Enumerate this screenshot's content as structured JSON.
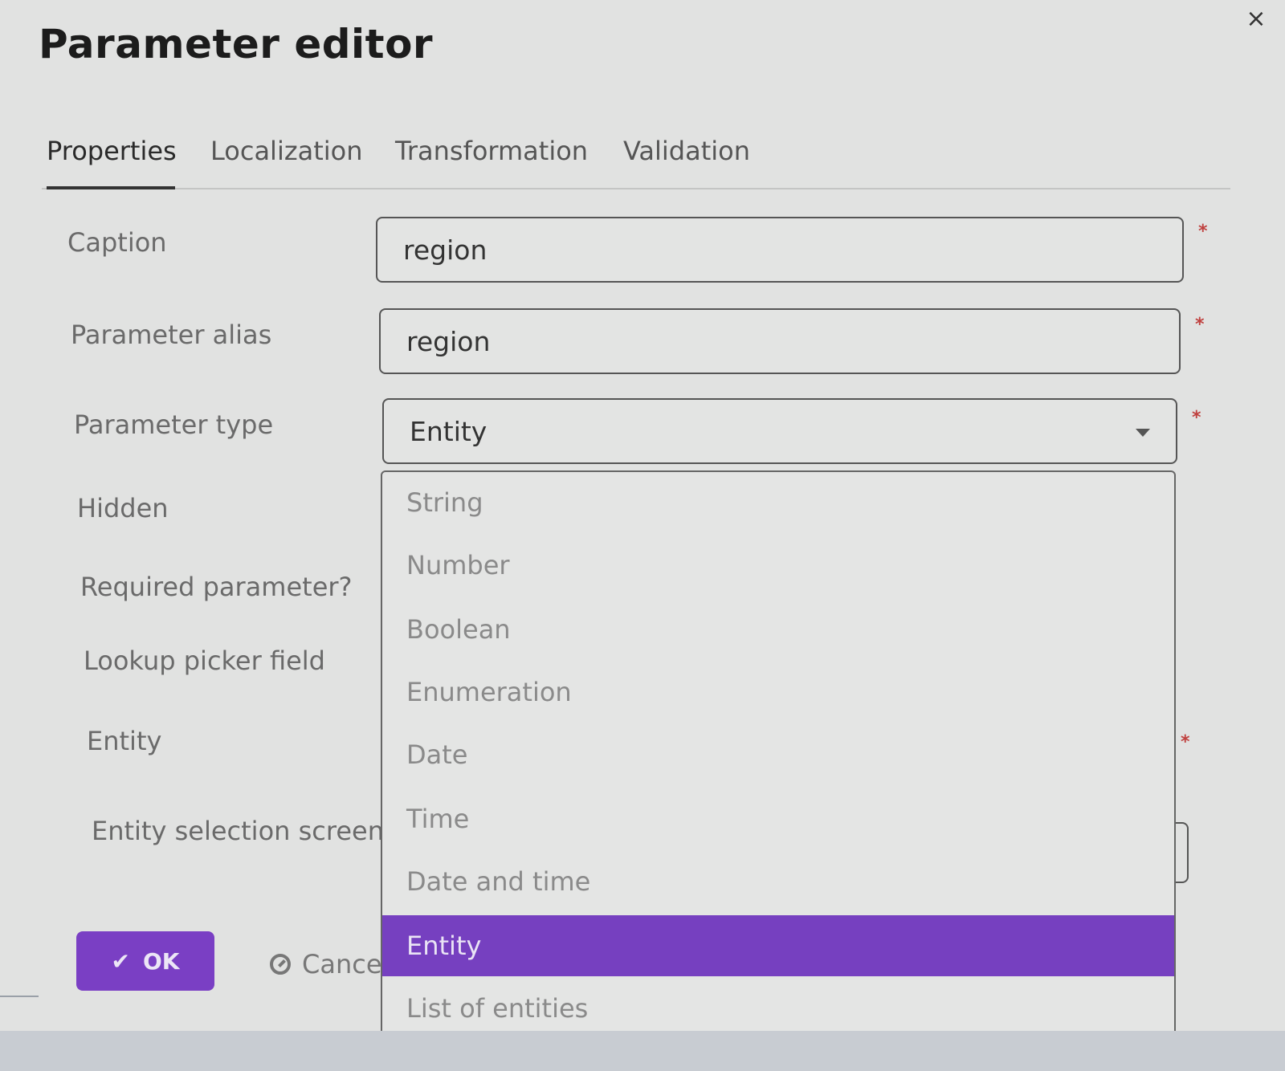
{
  "dialog": {
    "title": "Parameter editor",
    "close_icon": "×"
  },
  "tabs": [
    {
      "label": "Properties",
      "active": true
    },
    {
      "label": "Localization"
    },
    {
      "label": "Transformation"
    },
    {
      "label": "Validation"
    }
  ],
  "form": {
    "caption": {
      "label": "Caption",
      "value": "region",
      "required_mark": "*"
    },
    "alias": {
      "label": "Parameter alias",
      "value": "region",
      "required_mark": "*"
    },
    "type": {
      "label": "Parameter type",
      "value": "Entity",
      "required_mark": "*"
    },
    "hidden": {
      "label": "Hidden"
    },
    "required": {
      "label": "Required parameter?"
    },
    "lookup": {
      "label": "Lookup picker field"
    },
    "entity": {
      "label": "Entity",
      "required_mark": "*"
    },
    "screen": {
      "label": "Entity selection screen"
    }
  },
  "dropdown": {
    "options": [
      "String",
      "Number",
      "Boolean",
      "Enumeration",
      "Date",
      "Time",
      "Date and time",
      "Entity",
      "List of entities"
    ],
    "selected": "Entity"
  },
  "buttons": {
    "ok_label": "OK",
    "ok_icon": "✔",
    "cancel_label": "Cancel"
  },
  "colors": {
    "accent": "#7a3fc4",
    "required": "#c0413f"
  }
}
